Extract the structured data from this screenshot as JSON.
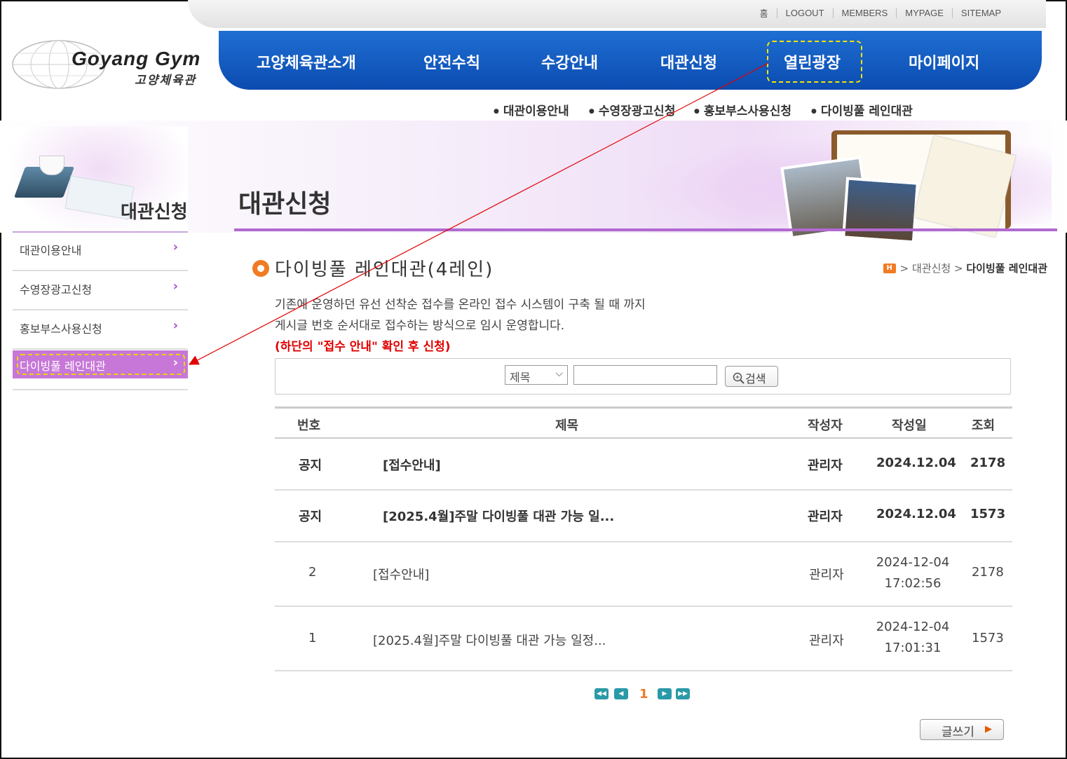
{
  "util_links": [
    "홈",
    "LOGOUT",
    "MEMBERS",
    "MYPAGE",
    "SITEMAP"
  ],
  "logo": {
    "title": "Goyang Gym",
    "subtitle": "고양체육관"
  },
  "nav": [
    "고양체육관소개",
    "안전수칙",
    "수강안내",
    "대관신청",
    "열린광장",
    "마이페이지"
  ],
  "subnav": [
    "대관이용안내",
    "수영장광고신청",
    "홍보부스사용신청",
    "다이빙풀 레인대관"
  ],
  "left_title": "대관신청",
  "page_title": "대관신청",
  "sidebar": [
    {
      "label": "대관이용안내"
    },
    {
      "label": "수영장광고신청"
    },
    {
      "label": "홍보부스사용신청"
    },
    {
      "label": "다이빙풀 레인대관"
    }
  ],
  "chevron": "›",
  "section_title": "다이빙풀 레인대관(4레인)",
  "breadcrumb": {
    "home": "H",
    "sep": ">",
    "level1": "대관신청",
    "current": "다이빙풀 레인대관"
  },
  "intro": {
    "line1": "기존에 운영하던 유선 선착순 접수를 온라인 접수 시스템이 구축 될 때 까지",
    "line2": "게시글 번호 순서대로 접수하는 방식으로 임시 운영합니다.",
    "notice": "(하단의 \"접수 안내\" 확인 후 신청)"
  },
  "search": {
    "select_value": "제목",
    "input_value": "",
    "button": "검색"
  },
  "table": {
    "headers": [
      "번호",
      "제목",
      "작성자",
      "작성일",
      "조회"
    ],
    "rows": [
      {
        "no": "공지",
        "title": "[접수안내]",
        "author": "관리자",
        "date": "2024.12.04",
        "time": "",
        "views": "2178"
      },
      {
        "no": "공지",
        "title": "[2025.4월]주말 다이빙풀 대관 가능 일...",
        "author": "관리자",
        "date": "2024.12.04",
        "time": "",
        "views": "1573"
      },
      {
        "no": "2",
        "title": "[접수안내]",
        "author": "관리자",
        "date": "2024-12-04",
        "time": "17:02:56",
        "views": "2178"
      },
      {
        "no": "1",
        "title": "[2025.4월]주말 다이빙풀 대관 가능 일정...",
        "author": "관리자",
        "date": "2024-12-04",
        "time": "17:01:31",
        "views": "1573"
      }
    ]
  },
  "pager": {
    "current": "1"
  },
  "write_button": "글쓰기",
  "colors": {
    "nav_blue": "#0b4bb0",
    "accent_purple": "#c777d8",
    "highlight_yellow": "#f5e600",
    "arrow_red": "#e00000"
  }
}
